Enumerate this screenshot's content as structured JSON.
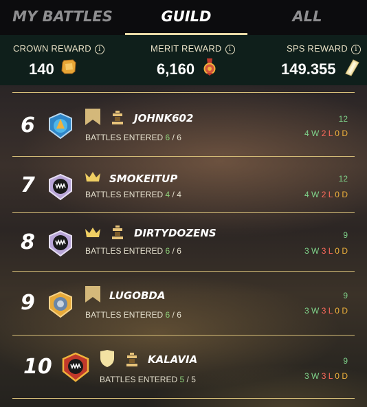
{
  "tabs": [
    {
      "label": "MY BATTLES",
      "active": false
    },
    {
      "label": "GUILD",
      "active": true
    },
    {
      "label": "ALL",
      "active": false
    }
  ],
  "rewards": {
    "crown": {
      "label": "CROWN REWARD",
      "value": "140",
      "icon": "crown-token-icon"
    },
    "merit": {
      "label": "MERIT REWARD",
      "value": "6,160",
      "icon": "merit-medal-icon"
    },
    "sps": {
      "label": "SPS REWARD",
      "value": "149.355",
      "icon": "sps-shard-icon"
    },
    "info_glyph": "i"
  },
  "players": [
    {
      "rank": "6",
      "name": "JOHNK602",
      "entered_label": "BATTLES ENTERED",
      "entered": "6",
      "sep": " / ",
      "total": "6",
      "score": "12",
      "w": "4",
      "l": "2",
      "d": "0",
      "league": "banner",
      "role": "knight"
    },
    {
      "rank": "7",
      "name": "SMOKEITUP",
      "entered_label": "BATTLES ENTERED",
      "entered": "4",
      "sep": " / ",
      "total": "4",
      "score": "12",
      "w": "4",
      "l": "2",
      "d": "0",
      "league": "crown",
      "role": ""
    },
    {
      "rank": "8",
      "name": "DIRTYDOZENS",
      "entered_label": "BATTLES ENTERED",
      "entered": "6",
      "sep": " / ",
      "total": "6",
      "score": "9",
      "w": "3",
      "l": "3",
      "d": "0",
      "league": "crown",
      "role": "knight"
    },
    {
      "rank": "9",
      "name": "LUGOBDA",
      "entered_label": "BATTLES ENTERED",
      "entered": "6",
      "sep": " / ",
      "total": "6",
      "score": "9",
      "w": "3",
      "l": "3",
      "d": "0",
      "league": "banner",
      "role": ""
    },
    {
      "rank": "10",
      "name": "KALAVIA",
      "entered_label": "BATTLES ENTERED",
      "entered": "5",
      "sep": " / ",
      "total": "5",
      "score": "9",
      "w": "3",
      "l": "3",
      "d": "0",
      "league": "shield",
      "role": "knight"
    }
  ],
  "wld_letters": {
    "w": "W",
    "l": "L",
    "d": "D"
  },
  "colors": {
    "accent": "#e8d9a6",
    "win": "#7fd28a",
    "loss": "#ff6a5c",
    "draw": "#f0b23c",
    "divider": "#d8c07a"
  }
}
